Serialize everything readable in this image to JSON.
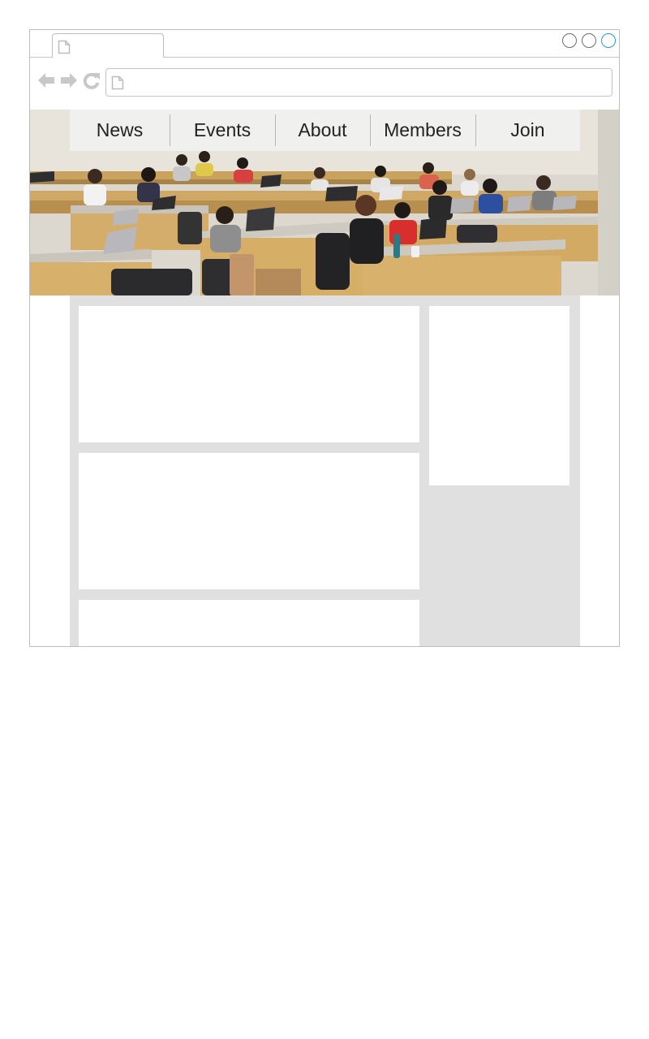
{
  "browser": {
    "tab": {
      "title": "",
      "icon": "page-icon"
    },
    "window_controls": [
      "minimize-button",
      "maximize-button",
      "close-button"
    ],
    "toolbar": {
      "back_icon": "arrow-left-icon",
      "forward_icon": "arrow-right-icon",
      "reload_icon": "reload-icon"
    },
    "address_bar": {
      "value": "",
      "icon": "page-icon"
    }
  },
  "site": {
    "hero_image": "classroom-photo",
    "nav": {
      "items": [
        {
          "label": "News"
        },
        {
          "label": "Events"
        },
        {
          "label": "About"
        },
        {
          "label": "Members"
        },
        {
          "label": "Join"
        }
      ]
    }
  },
  "colors": {
    "close_accent": "#2a9ad6",
    "content_bg": "#e0e0e0",
    "nav_bg": "#f0f0f0"
  }
}
